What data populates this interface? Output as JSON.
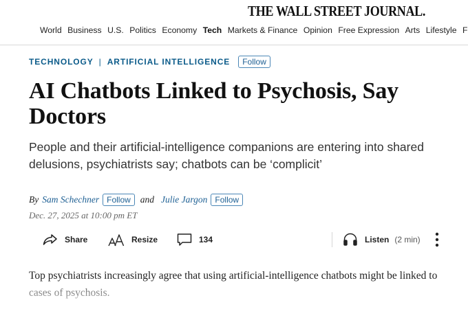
{
  "header": {
    "masthead": "THE WALL STREET JOURNAL."
  },
  "nav": {
    "items": [
      "World",
      "Business",
      "U.S.",
      "Politics",
      "Economy",
      "Tech",
      "Markets & Finance",
      "Opinion",
      "Free Expression",
      "Arts",
      "Lifestyle",
      "F"
    ],
    "active": "Tech"
  },
  "article": {
    "section": "TECHNOLOGY",
    "subsection": "ARTIFICIAL INTELLIGENCE",
    "section_separator": "|",
    "follow_label": "Follow",
    "headline": "AI Chatbots Linked to Psychosis, Say Doctors",
    "dek": "People and their artificial-intelligence companions are entering into shared delusions, psychiatrists say; chatbots can be ‘complicit’",
    "byline_prefix": "By",
    "authors": [
      "Sam Schechner",
      "Julie Jargon"
    ],
    "byline_and": "and",
    "date": "Dec. 27, 2025 at 10:00 pm ET",
    "body_lead": "Top psychiatrists increasingly agree that using artificial-intelligence chatbots might be linked to cases of psychosis."
  },
  "toolbar": {
    "share_label": "Share",
    "resize_label": "Resize",
    "comment_count": "134",
    "listen_label": "Listen",
    "listen_duration": "(2 min)",
    "icons": {
      "share": "share-icon",
      "resize": "text-resize-icon",
      "comments": "comment-icon",
      "listen": "headphones-icon",
      "more": "more-vertical-icon"
    }
  },
  "colors": {
    "link_blue": "#1d5f93",
    "section_blue": "#0b5b8a",
    "text": "#111111"
  }
}
